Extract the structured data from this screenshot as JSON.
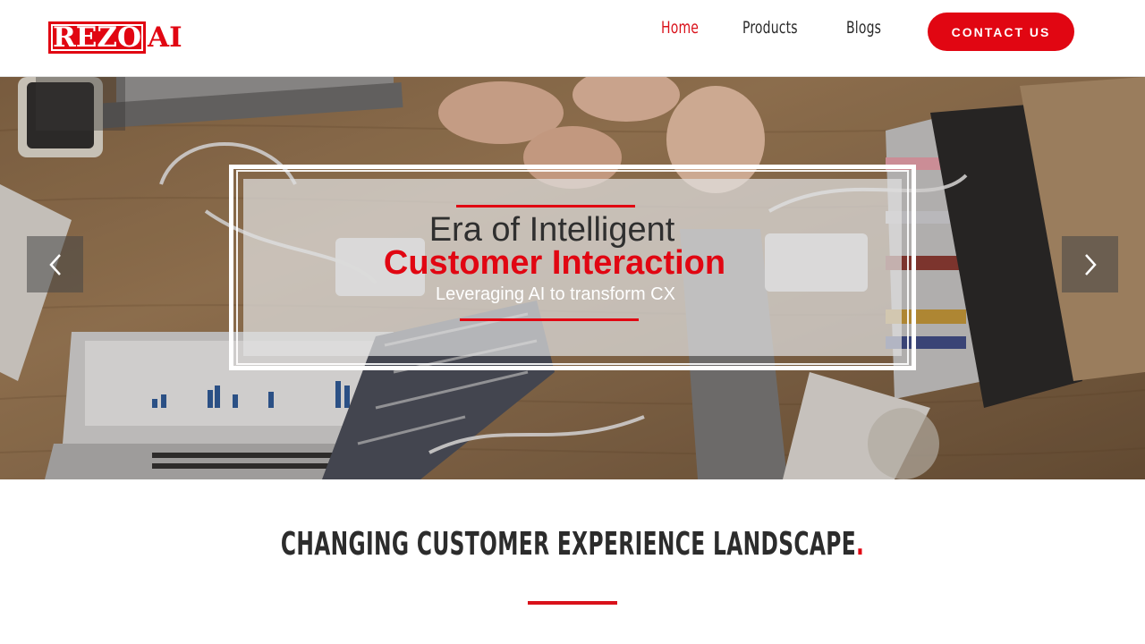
{
  "header": {
    "logo": {
      "part_a": "REZO",
      "part_b": "AI",
      "brand_color": "#e10612"
    },
    "nav": [
      {
        "label": "Home",
        "active": true
      },
      {
        "label": "Products",
        "active": false
      },
      {
        "label": "Blogs",
        "active": false
      }
    ],
    "contact_label": "CONTACT US"
  },
  "hero": {
    "line1": "Era of Intelligent",
    "line2": "Customer Interaction",
    "line3": "Leveraging AI to transform CX",
    "prev_icon": "chevron-left-icon",
    "next_icon": "chevron-right-icon",
    "accent_color": "#e10612"
  },
  "section": {
    "title": "CHANGING CUSTOMER EXPERIENCE LANDSCAPE",
    "title_dot": "."
  }
}
